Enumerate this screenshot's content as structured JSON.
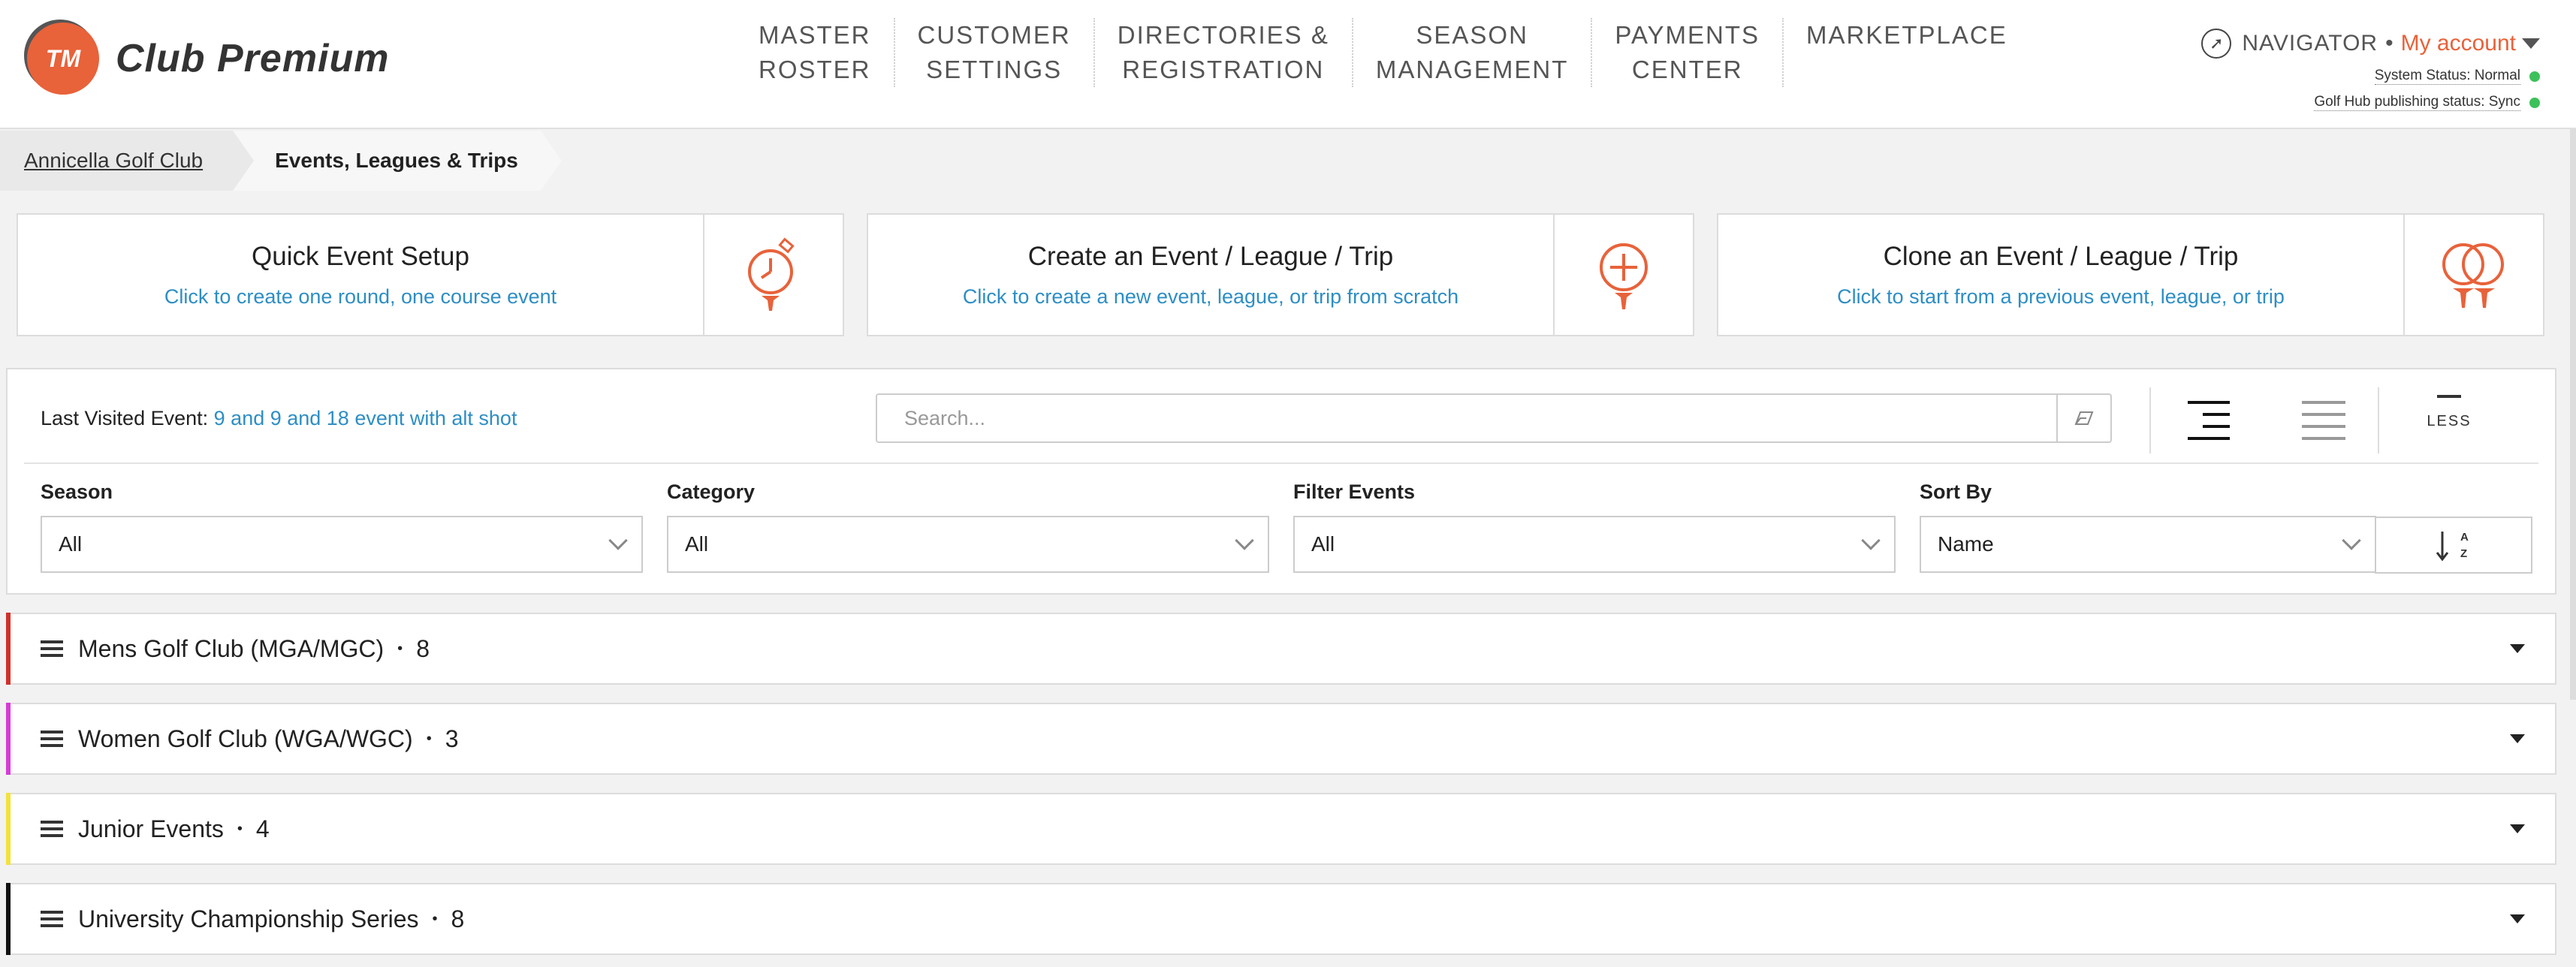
{
  "brand": {
    "logo_initials": "TM",
    "name": "Club Premium",
    "accent_color": "#e8623a"
  },
  "nav": {
    "items": [
      {
        "line1": "MASTER",
        "line2": "ROSTER"
      },
      {
        "line1": "CUSTOMER",
        "line2": "SETTINGS"
      },
      {
        "line1": "DIRECTORIES &",
        "line2": "REGISTRATION"
      },
      {
        "line1": "SEASON",
        "line2": "MANAGEMENT"
      },
      {
        "line1": "PAYMENTS",
        "line2": "CENTER"
      },
      {
        "line1": "MARKETPLACE",
        "line2": ""
      }
    ],
    "navigator": "NAVIGATOR",
    "separator": "•",
    "account": "My account",
    "system_status": "System Status: Normal",
    "hub_status": "Golf Hub publishing status: Sync",
    "status_color": "#3cc15a"
  },
  "breadcrumb": {
    "parent": "Annicella Golf Club",
    "current": "Events, Leagues & Trips"
  },
  "cards": [
    {
      "title": "Quick Event Setup",
      "subtitle": "Click to create one round, one course event",
      "icon": "stopwatch-tee-icon"
    },
    {
      "title": "Create an Event / League / Trip",
      "subtitle": "Click to create a new event, league, or trip from scratch",
      "icon": "plus-tee-icon"
    },
    {
      "title": "Clone an Event / League / Trip",
      "subtitle": "Click to start from a previous event, league, or trip",
      "icon": "double-tee-icon"
    }
  ],
  "panel": {
    "last_visited_label": "Last Visited Event:",
    "last_visited_event": "9 and 9 and 18 event with alt shot",
    "search_placeholder": "Search...",
    "less_label": "LESS"
  },
  "filters": {
    "season": {
      "label": "Season",
      "value": "All"
    },
    "category": {
      "label": "Category",
      "value": "All"
    },
    "filter_events": {
      "label": "Filter Events",
      "value": "All"
    },
    "sort_by": {
      "label": "Sort By",
      "value": "Name"
    },
    "sort_dir_top": "A",
    "sort_dir_bottom": "Z"
  },
  "groups": [
    {
      "name": "Mens Golf Club (MGA/MGC)",
      "count": "8",
      "color": "#d0302a"
    },
    {
      "name": "Women Golf Club (WGA/WGC)",
      "count": "3",
      "color": "#d83ad8"
    },
    {
      "name": "Junior Events",
      "count": "4",
      "color": "#f2e23a"
    },
    {
      "name": "University Championship Series",
      "count": "8",
      "color": "#111111"
    }
  ]
}
